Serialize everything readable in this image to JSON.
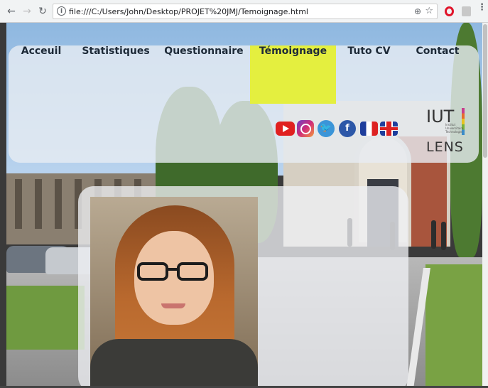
{
  "browser": {
    "url": "file:///C:/Users/John/Desktop/PROJET%20JMJ/Temoignage.html",
    "back_glyph": "←",
    "forward_glyph": "→",
    "reload_glyph": "↻",
    "info_glyph": "i",
    "zoom_glyph": "⊕",
    "star_glyph": "☆",
    "menu_glyph": "⋮"
  },
  "nav": {
    "items": [
      {
        "label": "Acceuil"
      },
      {
        "label": "Statistiques"
      },
      {
        "label": "Questionnaire"
      },
      {
        "label": "Témoignage"
      },
      {
        "label": "Tuto CV"
      },
      {
        "label": "Contact"
      }
    ],
    "active_index": 3,
    "active_color": "#e4ef3f"
  },
  "social": {
    "icons": [
      "youtube-icon",
      "instagram-icon",
      "twitter-icon",
      "facebook-icon"
    ],
    "twitter_glyph": "🐦",
    "facebook_glyph": "f",
    "flags": [
      "france-flag-icon",
      "uk-flag-icon"
    ]
  },
  "logo": {
    "top": "IUT",
    "bottom": "LENS",
    "subtitle": "Institut\nUniversitaire\nTechnologie"
  }
}
